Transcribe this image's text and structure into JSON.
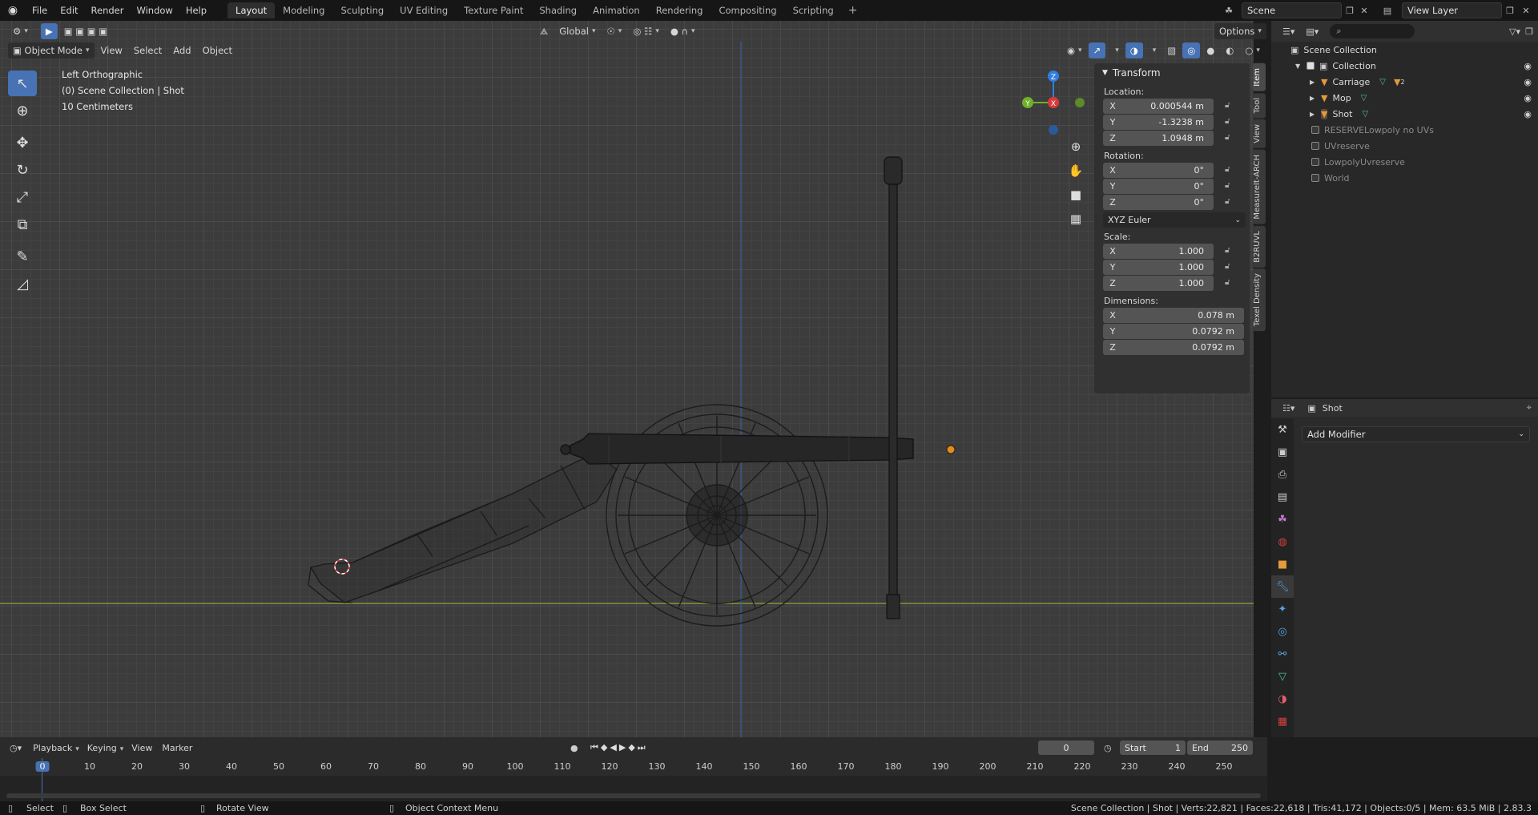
{
  "menubar": {
    "items": [
      "File",
      "Edit",
      "Render",
      "Window",
      "Help"
    ],
    "workspaces": [
      "Layout",
      "Modeling",
      "Sculpting",
      "UV Editing",
      "Texture Paint",
      "Shading",
      "Animation",
      "Rendering",
      "Compositing",
      "Scripting"
    ],
    "active_workspace": "Layout",
    "scene": "Scene",
    "view_layer": "View Layer"
  },
  "viewport": {
    "mode": "Object Mode",
    "menus": [
      "View",
      "Select",
      "Add",
      "Object"
    ],
    "orientation": "Global",
    "options": "Options",
    "view_name": "Left Orthographic",
    "context": "(0) Scene Collection | Shot",
    "scale": "10 Centimeters",
    "gizmo": {
      "z": "Z",
      "y": "Y",
      "x": "X"
    }
  },
  "npanel": {
    "title": "Transform",
    "location_label": "Location:",
    "location": [
      {
        "axis": "X",
        "value": "0.000544 m"
      },
      {
        "axis": "Y",
        "value": "-1.3238 m"
      },
      {
        "axis": "Z",
        "value": "1.0948 m"
      }
    ],
    "rotation_label": "Rotation:",
    "rotation": [
      {
        "axis": "X",
        "value": "0°"
      },
      {
        "axis": "Y",
        "value": "0°"
      },
      {
        "axis": "Z",
        "value": "0°"
      }
    ],
    "rotation_mode": "XYZ Euler",
    "scale_label": "Scale:",
    "scale": [
      {
        "axis": "X",
        "value": "1.000"
      },
      {
        "axis": "Y",
        "value": "1.000"
      },
      {
        "axis": "Z",
        "value": "1.000"
      }
    ],
    "dimensions_label": "Dimensions:",
    "dimensions": [
      {
        "axis": "X",
        "value": "0.078 m"
      },
      {
        "axis": "Y",
        "value": "0.0792 m"
      },
      {
        "axis": "Z",
        "value": "0.0792 m"
      }
    ],
    "tabs": [
      "Item",
      "Tool",
      "View",
      "MeasureIt-ARCH",
      "B2RUVL",
      "Texel Density"
    ]
  },
  "outliner": {
    "root": "Scene Collection",
    "collection": "Collection",
    "objects": [
      "Carriage",
      "Mop",
      "Shot"
    ],
    "carriage_badge": "2",
    "other": [
      "RESERVELowpoly no UVs",
      "UVreserve",
      "LowpolyUvreserve",
      "World"
    ]
  },
  "properties": {
    "object": "Shot",
    "add_modifier": "Add Modifier"
  },
  "timeline": {
    "menus": [
      "Playback",
      "Keying",
      "View",
      "Marker"
    ],
    "current_frame": "0",
    "start_label": "Start",
    "start": "1",
    "end_label": "End",
    "end": "250",
    "ticks": [
      "0",
      "10",
      "20",
      "30",
      "40",
      "50",
      "60",
      "70",
      "80",
      "90",
      "100",
      "110",
      "120",
      "130",
      "140",
      "150",
      "160",
      "170",
      "180",
      "190",
      "200",
      "210",
      "220",
      "230",
      "240",
      "250"
    ]
  },
  "statusbar": {
    "select": "Select",
    "box_select": "Box Select",
    "rotate_view": "Rotate View",
    "context_menu": "Object Context Menu",
    "stats": "Scene Collection | Shot | Verts:22,821 | Faces:22,618 | Tris:41,172 | Objects:0/5 | Mem: 63.5 MiB | 2.83.3"
  }
}
